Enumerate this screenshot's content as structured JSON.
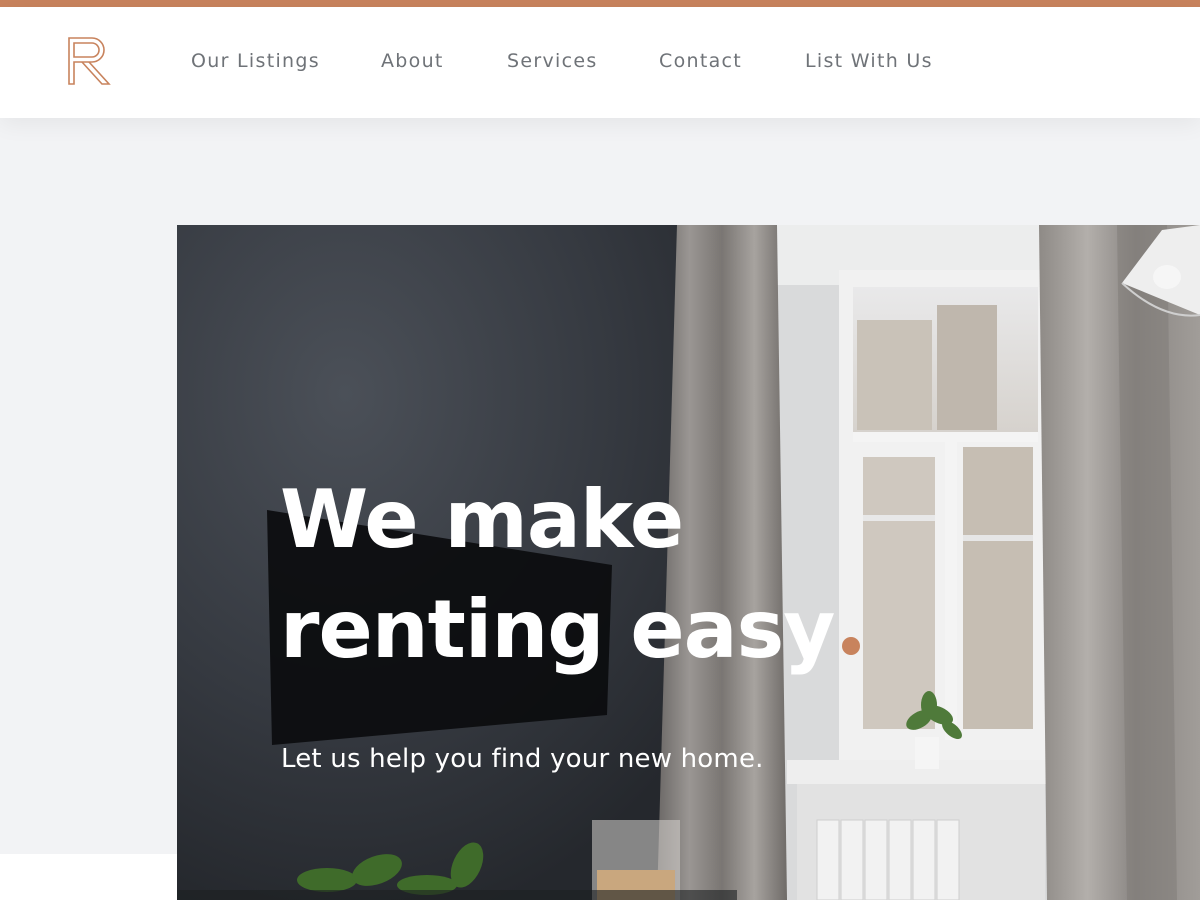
{
  "brand": {
    "logo_icon": "monogram-r-icon",
    "accent_color": "#c8835d"
  },
  "nav": {
    "items": [
      {
        "label": "Our Listings"
      },
      {
        "label": "About"
      },
      {
        "label": "Services"
      },
      {
        "label": "Contact"
      },
      {
        "label": "List With Us"
      }
    ]
  },
  "hero": {
    "headline_line1": "We make",
    "headline_line2": "renting easy",
    "subtitle": "Let us help you find your new home.",
    "image": "apartment-interior-photo"
  }
}
